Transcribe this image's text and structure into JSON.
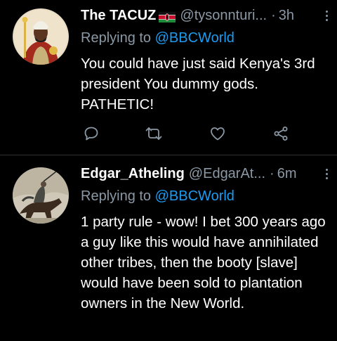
{
  "tweets": [
    {
      "author_name": "The TACUZ",
      "handle": "@tysonnturi...",
      "dot": "·",
      "time": "3h",
      "replying_prefix": "Replying to",
      "replying_to": "@BBCWorld",
      "body": "You could have just said Kenya's 3rd president You dummy gods. PATHETIC!",
      "flag_icon": "kenya-flag-icon"
    },
    {
      "author_name": "Edgar_Atheling",
      "handle": "@EdgarAt...",
      "dot": "·",
      "time": "6m",
      "replying_prefix": "Replying to",
      "replying_to": "@BBCWorld",
      "body": "1 party rule - wow! I bet 300 years ago a guy like this would have annihilated other tribes, then the booty [slave] would have been sold to plantation owners in the New World."
    }
  ],
  "colors": {
    "background": "#000000",
    "secondary_text": "#8b98a5",
    "mention": "#1d9bf0",
    "divider": "#2f3336"
  }
}
